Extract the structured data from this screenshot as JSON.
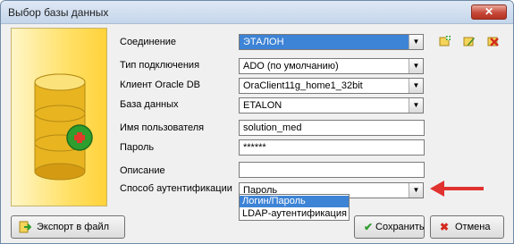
{
  "window": {
    "title": "Выбор базы данных",
    "close_glyph": "✕"
  },
  "form": {
    "connection": {
      "label": "Соединение",
      "value": "ЭТАЛОН"
    },
    "connection_type": {
      "label": "Тип подключения",
      "value": "ADO (по умолчанию)"
    },
    "oracle_client": {
      "label": "Клиент Oracle DB",
      "value": "OraClient11g_home1_32bit"
    },
    "database": {
      "label": "База данных",
      "value": "ETALON"
    },
    "username": {
      "label": "Имя пользователя",
      "value": "solution_med"
    },
    "password": {
      "label": "Пароль",
      "value": "******"
    },
    "description": {
      "label": "Описание",
      "value": ""
    },
    "auth_method": {
      "label": "Способ аутентификации",
      "value": "Пароль",
      "options": [
        "Логин/Пароль",
        "LDAP-аутентификация"
      ],
      "highlighted": "Логин/Пароль"
    }
  },
  "toolbar_icons": [
    "add-connection-icon",
    "edit-connection-icon",
    "delete-connection-icon"
  ],
  "buttons": {
    "export_label": "Экспорт в файл",
    "save_label": "Сохранить",
    "cancel_label": "Отмена"
  },
  "colors": {
    "selection": "#3d83d6",
    "arrow": "#e0322f",
    "banner": "#ffe066",
    "window_bg": "#f0f0f0"
  }
}
